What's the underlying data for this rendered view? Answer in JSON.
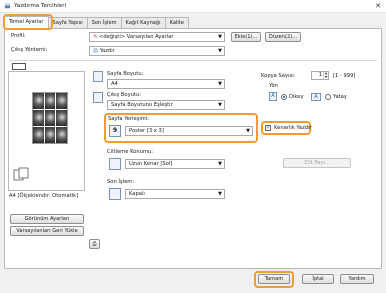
{
  "window": {
    "title": "Yazdırma Tercihleri",
    "close_glyph": "✕"
  },
  "tabs": [
    {
      "label": "Temel Ayarlar",
      "active": true
    },
    {
      "label": "Sayfa Yapısı"
    },
    {
      "label": "Son İşlem"
    },
    {
      "label": "Kağıt Kaynağı"
    },
    {
      "label": "Kalite"
    }
  ],
  "profile": {
    "label": "Profil:",
    "value": "<değişti> Varsayılan Ayarlar",
    "add_button": "Ekle(1)...",
    "edit_button": "Düzen(2)..."
  },
  "output_method": {
    "label": "Çıkış Yöntemi:",
    "value": "Yazdır"
  },
  "preview": {
    "caption": "A4 [Ölçeklendir: Otomatik]",
    "view_settings_button": "Görünüm Ayarları",
    "restore_defaults_button": "Varsayılanları Geri Yükle"
  },
  "page_size": {
    "label": "Sayfa Boyutu:",
    "value": "A4"
  },
  "output_size": {
    "label": "Çıkış Boyutu:",
    "value": "Sayfa Boyutunu Eşleştir"
  },
  "copies": {
    "label": "Kopya Sayısı:",
    "value": "1",
    "range": "[1 - 999]"
  },
  "orientation": {
    "label": "Yön",
    "portrait": "Dikey",
    "landscape": "Yatay",
    "selected": "portrait"
  },
  "layout": {
    "label": "Sayfa Yerleşimi:",
    "value": "Poster [3 x 3]",
    "icon_text": "9",
    "border_label": "Kenarlık Yazdır",
    "border_checked": true
  },
  "binding": {
    "label": "Ciltleme Konumu:",
    "value": "Uzun Kenar [Sol]",
    "gutter_button": "Cilt Payı..."
  },
  "finishing": {
    "label": "Son İşlem:",
    "value": "Kapalı"
  },
  "footer": {
    "ok": "Tamam",
    "cancel": "İptal",
    "help": "Yardım"
  },
  "colors": {
    "highlight": "#f39b2c",
    "accent": "#1a5fb4"
  }
}
